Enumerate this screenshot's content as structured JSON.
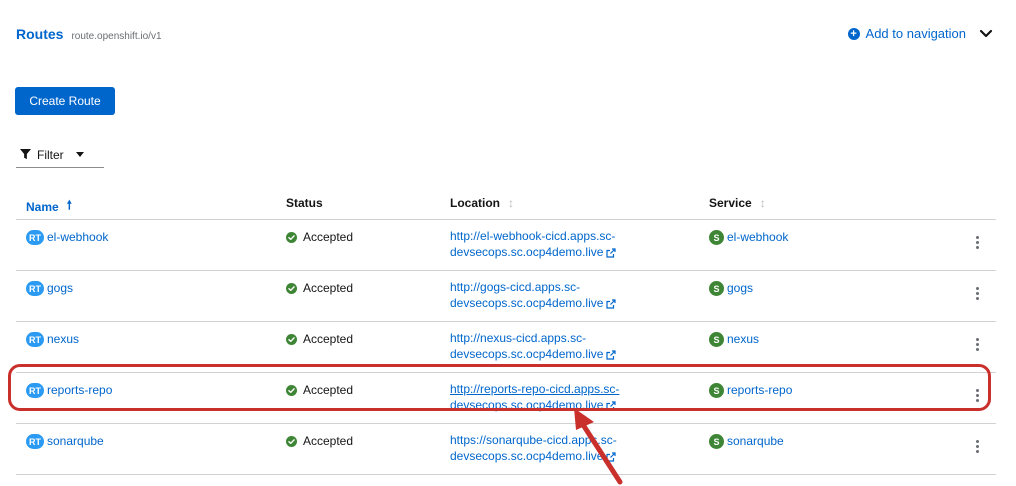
{
  "header": {
    "title": "Routes",
    "api_version": "route.openshift.io/v1",
    "add_to_navigation": "Add to navigation"
  },
  "toolbar": {
    "create_label": "Create Route",
    "filter_label": "Filter"
  },
  "table": {
    "columns": [
      "Name",
      "Status",
      "Location",
      "Service"
    ],
    "rows": [
      {
        "badge": "RT",
        "name": "el-webhook",
        "status": "Accepted",
        "location_line1": "http://el-webhook-cicd.apps.sc-",
        "location_line2": "devsecops.sc.ocp4demo.live",
        "service_badge": "S",
        "service": "el-webhook"
      },
      {
        "badge": "RT",
        "name": "gogs",
        "status": "Accepted",
        "location_line1": "http://gogs-cicd.apps.sc-",
        "location_line2": "devsecops.sc.ocp4demo.live",
        "service_badge": "S",
        "service": "gogs"
      },
      {
        "badge": "RT",
        "name": "nexus",
        "status": "Accepted",
        "location_line1": "http://nexus-cicd.apps.sc-",
        "location_line2": "devsecops.sc.ocp4demo.live",
        "service_badge": "S",
        "service": "nexus"
      },
      {
        "badge": "RT",
        "name": "reports-repo",
        "status": "Accepted",
        "location_line1": "http://reports-repo-cicd.apps.sc-",
        "location_line2": "devsecops.sc.ocp4demo.live",
        "service_badge": "S",
        "service": "reports-repo"
      },
      {
        "badge": "RT",
        "name": "sonarqube",
        "status": "Accepted",
        "location_line1": "https://sonarqube-cicd.apps.sc-",
        "location_line2": "devsecops.sc.ocp4demo.live",
        "service_badge": "S",
        "service": "sonarqube"
      }
    ]
  },
  "colors": {
    "link": "#0066cc",
    "primary_button": "#0066cc",
    "route_badge": "#2b9af3",
    "service_badge": "#3e8635",
    "status_ok": "#3e8635",
    "annotation": "#c9302c"
  },
  "icons": {
    "add_nav": "plus-circle-icon",
    "expand": "chevron-down-icon",
    "filter": "filter-icon",
    "sort_asc": "arrow-up-icon",
    "sort": "sort-icon",
    "status": "check-circle-icon",
    "external_link": "external-link-icon",
    "row_actions": "kebab-icon"
  }
}
